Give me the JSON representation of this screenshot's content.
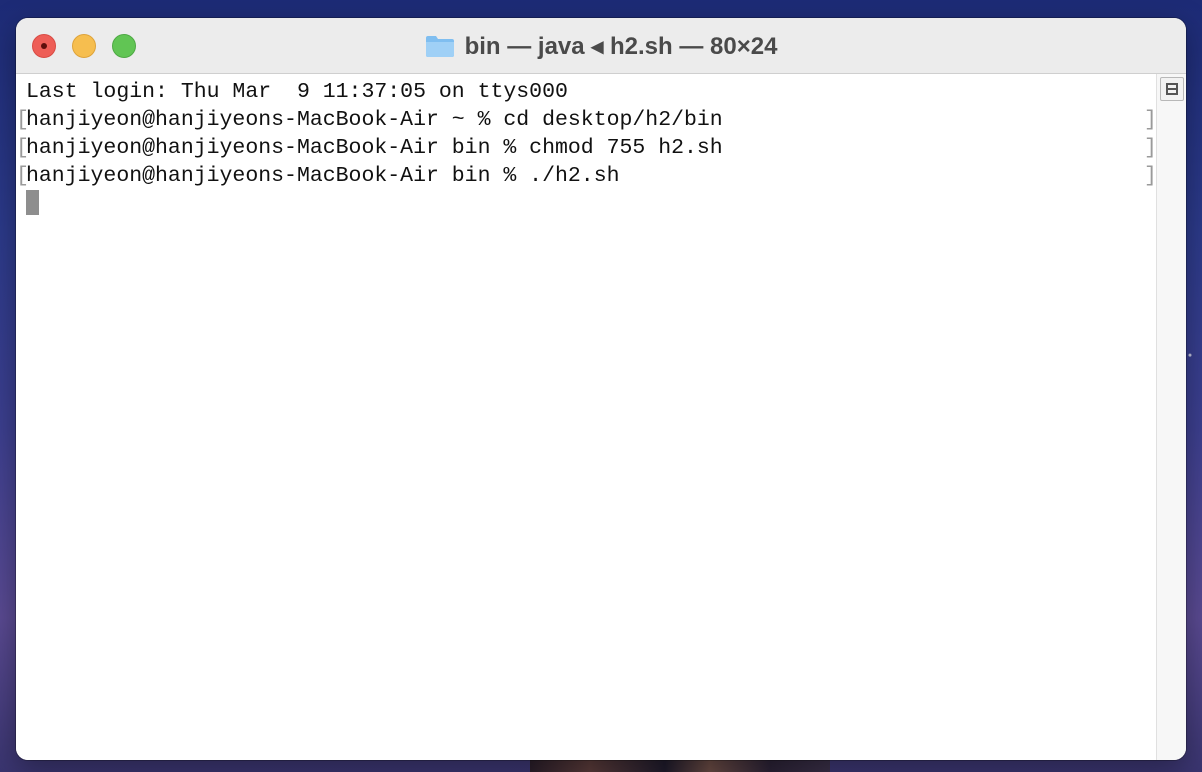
{
  "window": {
    "title": "bin — java ◂ h2.sh — 80×24"
  },
  "terminal": {
    "lines": [
      "Last login: Thu Mar  9 11:37:05 on ttys000",
      "hanjiyeon@hanjiyeons-MacBook-Air ~ % cd desktop/h2/bin",
      "hanjiyeon@hanjiyeons-MacBook-Air bin % chmod 755 h2.sh",
      "hanjiyeon@hanjiyeons-MacBook-Air bin % ./h2.sh"
    ],
    "bracket_open": "[",
    "bracket_close": "]"
  },
  "icons": {
    "title_icon": "folder-icon",
    "scroll_control": "split-pane-icon"
  },
  "colors": {
    "close": "#ee5e57",
    "minimize": "#f6be4f",
    "zoom": "#61c554",
    "cursor": "#8e8e8e"
  }
}
